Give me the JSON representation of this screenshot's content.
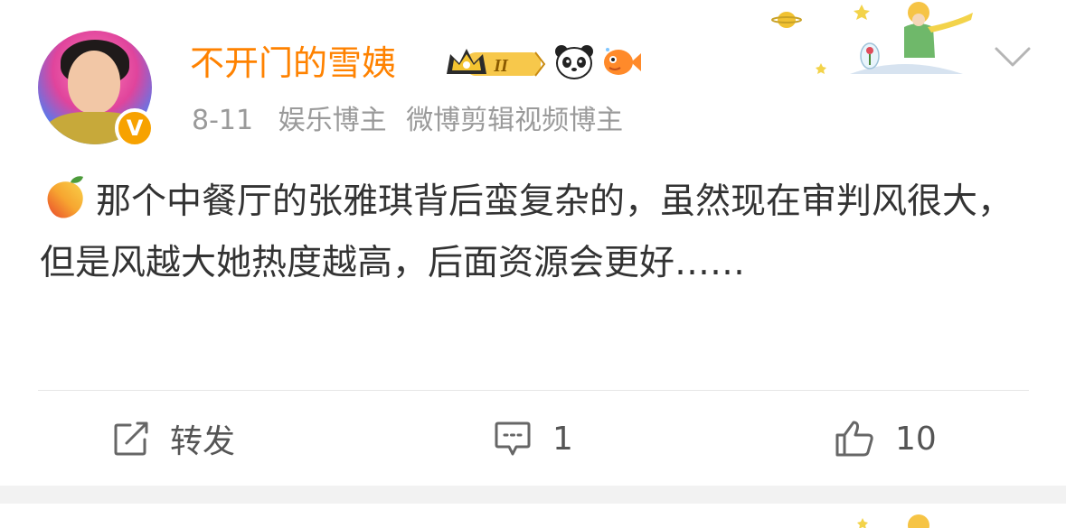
{
  "post": {
    "username": "不开门的雪姨",
    "vip_level": "II",
    "date": "8-11",
    "tags": [
      "娱乐博主",
      "微博剪辑视频博主"
    ],
    "body_text": "那个中餐厅的张雅琪背后蛮复杂的，虽然现在审判风很大，但是风越大她热度越高，后面资源会更好……",
    "emoji_inline": "mango-emoji"
  },
  "actions": {
    "repost_label": "转发",
    "comment_count": "1",
    "like_count": "10"
  },
  "colors": {
    "username": "#ff8200",
    "meta": "#9a9a9a",
    "body": "#333333",
    "verified": "#f7a200"
  },
  "icons": [
    "verified-icon",
    "vip-crown-icon",
    "panda-icon",
    "fish-icon",
    "chevron-down-icon",
    "repost-icon",
    "comment-icon",
    "like-icon",
    "mango-icon"
  ]
}
